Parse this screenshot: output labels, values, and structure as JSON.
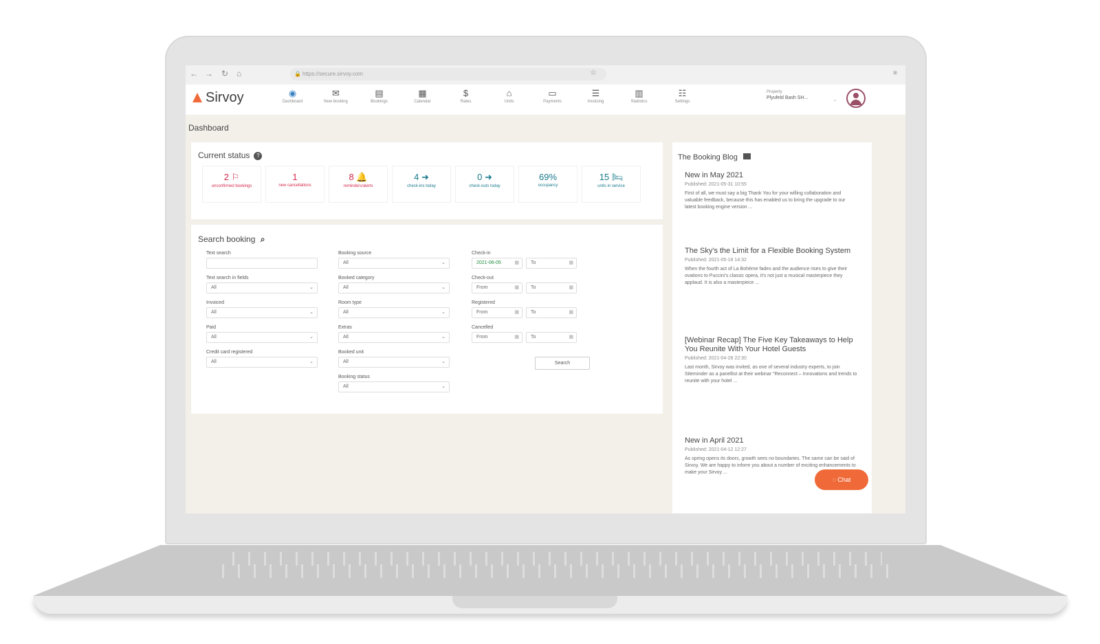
{
  "browser": {
    "back": "←",
    "forward": "→",
    "reload": "↻",
    "home": "⌂",
    "url": "https://secure.sirvoy.com",
    "lock": "🔒",
    "bookmark": "☆",
    "menu": "≡"
  },
  "app": {
    "logo_text": "Sirvoy",
    "nav": [
      {
        "label": "Dashboard",
        "icon": "◉"
      },
      {
        "label": "New booking",
        "icon": "✉"
      },
      {
        "label": "Bookings",
        "icon": "▤"
      },
      {
        "label": "Calendar",
        "icon": "▦"
      },
      {
        "label": "Rates",
        "icon": "$"
      },
      {
        "label": "Units",
        "icon": "⌂"
      },
      {
        "label": "Payments",
        "icon": "▭"
      },
      {
        "label": "Invoicing",
        "icon": "☰"
      },
      {
        "label": "Statistics",
        "icon": "▥"
      },
      {
        "label": "Settings",
        "icon": "☷"
      }
    ],
    "user": {
      "label": "Property",
      "property": "Plyufeld Bash SH..."
    }
  },
  "page_title": "Dashboard",
  "current_status": {
    "title": "Current status",
    "help_icon": "?",
    "tiles": [
      {
        "value": "2 ⚐",
        "label": "unconfirmed bookings",
        "color": "#d4284a"
      },
      {
        "value": "1",
        "label": "new cancellations",
        "color": "#d4284a"
      },
      {
        "value": "8 🔔",
        "label": "reminders/alerts",
        "color": "#d4284a"
      },
      {
        "value": "4 ➜",
        "label": "check-ins today",
        "color": "#17798b"
      },
      {
        "value": "0 ➜",
        "label": "check-outs today",
        "color": "#17798b"
      },
      {
        "value": "69%",
        "label": "occupancy",
        "color": "#17798b"
      },
      {
        "value": "15 🛏",
        "label": "units in service",
        "color": "#17798b"
      }
    ]
  },
  "search_booking": {
    "title": "Search booking",
    "search_icon": "⌕",
    "col1": [
      {
        "label": "Text search",
        "value": "",
        "type": "text"
      },
      {
        "label": "Text search in fields",
        "value": "All",
        "type": "select"
      },
      {
        "label": "Invoiced",
        "value": "All",
        "type": "select"
      },
      {
        "label": "Paid",
        "value": "All",
        "type": "select"
      },
      {
        "label": "Credit card registered",
        "value": "All",
        "type": "select"
      }
    ],
    "col2": [
      {
        "label": "Booking source",
        "value": "All",
        "type": "select"
      },
      {
        "label": "Booked category",
        "value": "All",
        "type": "select"
      },
      {
        "label": "Room type",
        "value": "All",
        "type": "select"
      },
      {
        "label": "Extras",
        "value": "All",
        "type": "select"
      },
      {
        "label": "Booked unit",
        "value": "All",
        "type": "select"
      },
      {
        "label": "Booking status",
        "value": "All",
        "type": "select"
      }
    ],
    "col3": [
      {
        "label": "Check-in",
        "from": "2021-06-05",
        "to": "To"
      },
      {
        "label": "Check-out",
        "from": "From",
        "to": "To"
      },
      {
        "label": "Registered",
        "from": "From",
        "to": "To"
      },
      {
        "label": "Cancelled",
        "from": "From",
        "to": "To"
      }
    ],
    "chevron": "⌄",
    "calendar_icon": "▦",
    "search_button": "Search"
  },
  "blog": {
    "title": "The Booking Blog",
    "posts": [
      {
        "heading": "New in May 2021",
        "published": "Published: 2021-05-31 10:55",
        "teaser": "First of all, we must say a big Thank You for your willing collaboration and valuable feedback, because this has enabled us to bring the upgrade to our latest booking engine version ..."
      },
      {
        "heading": "The Sky's the Limit for a Flexible Booking System",
        "published": "Published: 2021-05-18 14:32",
        "teaser": "When the fourth act of La Bohème fades and the audience rises to give their ovations to Puccini's classic opera, it's not just a musical masterpiece they applaud. It is also a masterpiece ..."
      },
      {
        "heading": "[Webinar Recap] The Five Key Takeaways to Help You Reunite With Your Hotel Guests",
        "published": "Published: 2021-04-28 22:30",
        "teaser": "Last month, Sirvoy was invited, as one of several industry experts, to join Siteminder as a panellist at their webinar \"Reconnect – Innovations and trends to reunite with your hotel ..."
      },
      {
        "heading": "New in April 2021",
        "published": "Published: 2021-04-12 12:27",
        "teaser": "As spring opens its doors, growth sees no boundaries. The same can be said of Sirvoy. We are happy to inform you about a number of exciting enhancements to make your Sirvoy ..."
      }
    ]
  },
  "chat": {
    "label": "Chat",
    "icon": "◌"
  },
  "colors": {
    "brand_orange": "#f06a39",
    "alert_red": "#d4284a",
    "status_teal": "#17798b",
    "content_bg": "#f3f0ea"
  }
}
